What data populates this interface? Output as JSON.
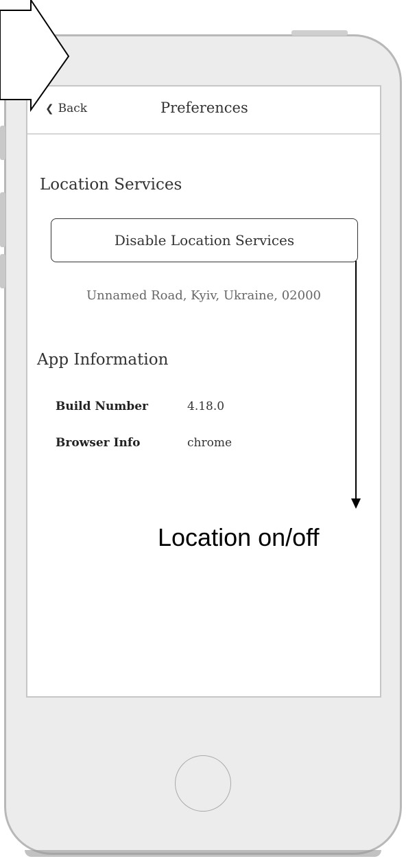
{
  "navbar": {
    "back_label": "Back",
    "title": "Preferences"
  },
  "location": {
    "section_title": "Location Services",
    "button_label": "Disable Location Services",
    "address": "Unnamed Road, Kyiv, Ukraine, 02000"
  },
  "app_info": {
    "section_title": "App Information",
    "rows": [
      {
        "label": "Build Number",
        "value": "4.18.0"
      },
      {
        "label": "Browser Info",
        "value": "chrome"
      }
    ]
  },
  "annotation": {
    "text": "Location on/off"
  },
  "icons": {
    "back": "chevron-left-icon",
    "home": "home-button-icon",
    "pointer": "arrow-pointer-icon"
  }
}
